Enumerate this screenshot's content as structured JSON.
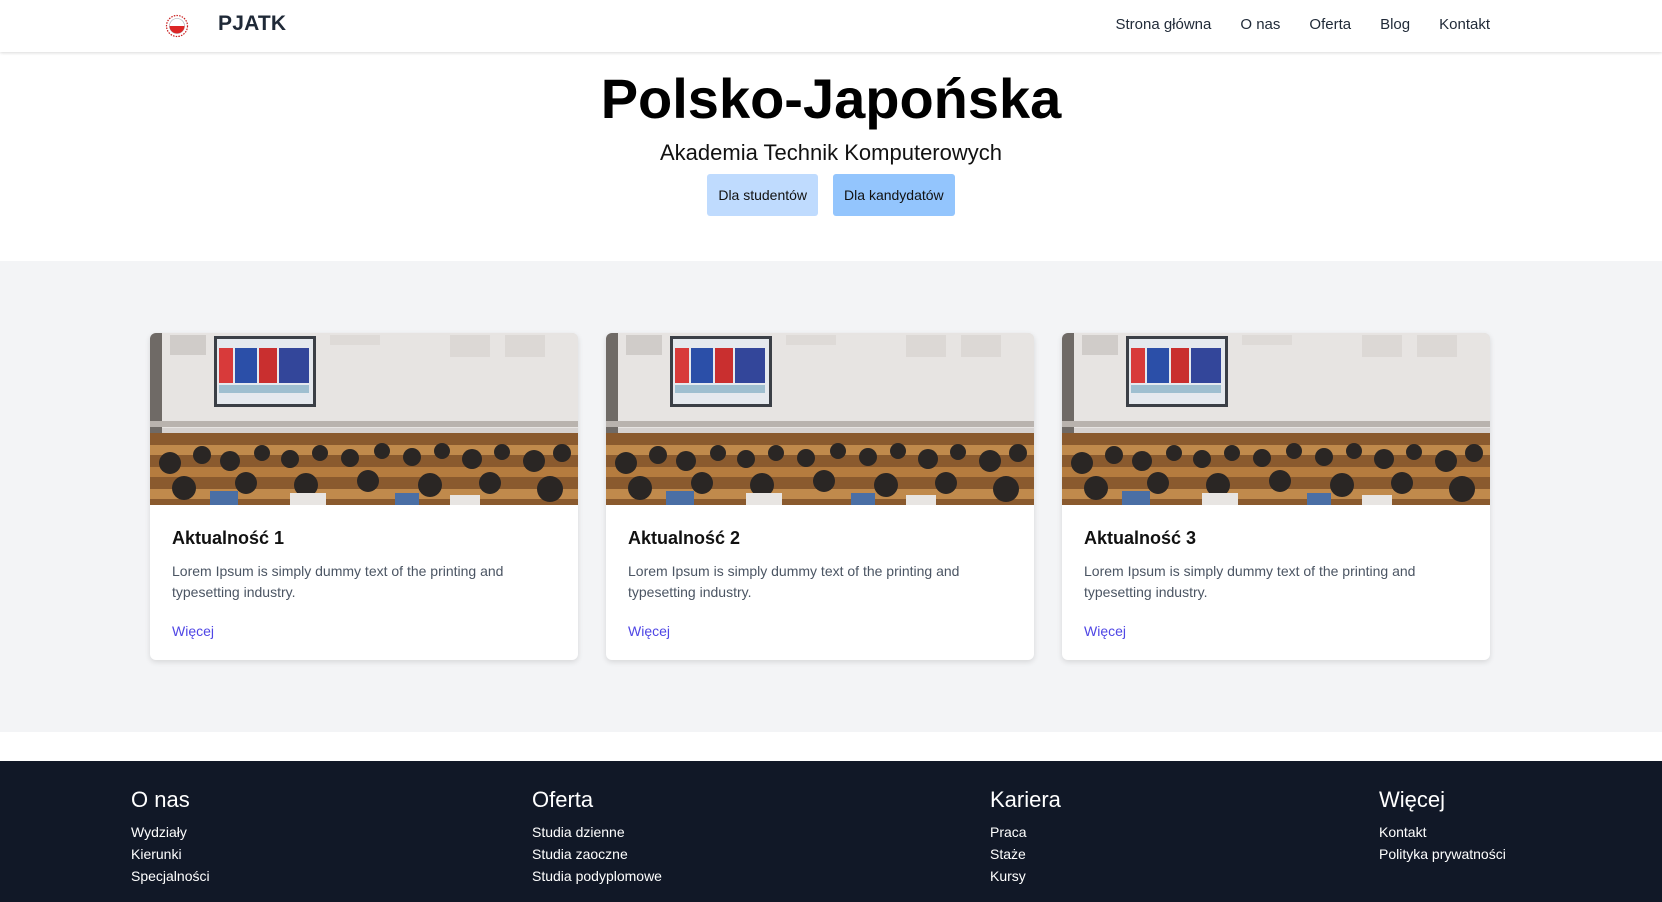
{
  "colors": {
    "accent_link": "#4f46e5",
    "btn_students": "#bfdbfe",
    "btn_candidates": "#93c5fd",
    "footer_bg": "#111827",
    "news_bg": "#f3f4f6"
  },
  "navbar": {
    "logo_icon": "pjatk-logo-icon",
    "brand": "PJATK",
    "links": [
      "Strona główna",
      "O nas",
      "Oferta",
      "Blog",
      "Kontakt"
    ]
  },
  "hero": {
    "title": "Polsko-Japońska",
    "subtitle": "Akademia Technik Komputerowych",
    "buttons": {
      "students": "Dla studentów",
      "candidates": "Dla kandydatów"
    }
  },
  "news": {
    "cards": [
      {
        "title": "Aktualność 1",
        "text": "Lorem Ipsum is simply dummy text of the printing and typesetting industry.",
        "link": "Więcej"
      },
      {
        "title": "Aktualność 2",
        "text": "Lorem Ipsum is simply dummy text of the printing and typesetting industry.",
        "link": "Więcej"
      },
      {
        "title": "Aktualność 3",
        "text": "Lorem Ipsum is simply dummy text of the printing and typesetting industry.",
        "link": "Więcej"
      }
    ]
  },
  "footer": {
    "columns": [
      {
        "title": "O nas",
        "links": [
          "Wydziały",
          "Kierunki",
          "Specjalności"
        ]
      },
      {
        "title": "Oferta",
        "links": [
          "Studia dzienne",
          "Studia zaoczne",
          "Studia podyplomowe"
        ]
      },
      {
        "title": "Kariera",
        "links": [
          "Praca",
          "Staże",
          "Kursy"
        ]
      },
      {
        "title": "Więcej",
        "links": [
          "Kontakt",
          "Polityka prywatności"
        ]
      }
    ]
  }
}
